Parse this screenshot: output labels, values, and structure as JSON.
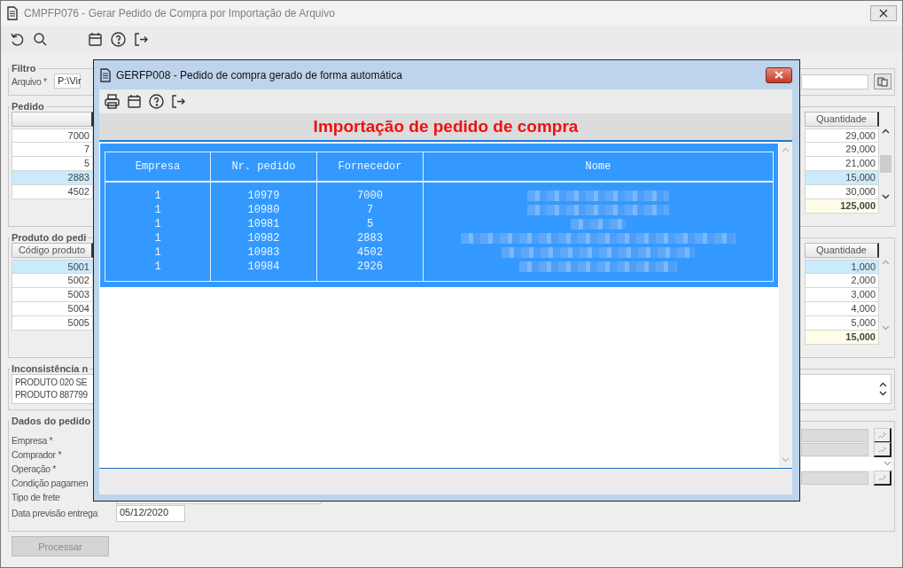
{
  "window": {
    "title": "CMPFP076 - Gerar Pedido de Compra por Importação de Arquivo"
  },
  "toolbar": [
    {
      "kind": "undo"
    },
    {
      "kind": "search"
    },
    {
      "kind": "gap"
    },
    {
      "kind": "calendar"
    },
    {
      "kind": "help"
    },
    {
      "kind": "exit"
    }
  ],
  "filter": {
    "legend": "Filtro",
    "label": "Arquivo *",
    "value": "P:\\Vir"
  },
  "order": {
    "legend": "Pedido",
    "quantity_header": "Quantidade",
    "total": "125,000",
    "rows": [
      {
        "code": "7000",
        "quantity": "29,000",
        "selected": false
      },
      {
        "code": "7",
        "quantity": "29,000",
        "selected": false
      },
      {
        "code": "5",
        "quantity": "21,000",
        "selected": false
      },
      {
        "code": "2883",
        "quantity": "15,000",
        "selected": true
      },
      {
        "code": "4502",
        "quantity": "30,000",
        "selected": false
      }
    ]
  },
  "product": {
    "legend": "Produto do pedi",
    "code_header": "Código produto",
    "quantity_header": "Quantidade",
    "total": "15,000",
    "rows": [
      {
        "code": "5001",
        "quantity": "1,000",
        "selected": true
      },
      {
        "code": "5002",
        "quantity": "2,000",
        "selected": false
      },
      {
        "code": "5003",
        "quantity": "3,000",
        "selected": false
      },
      {
        "code": "5004",
        "quantity": "4,000",
        "selected": false
      },
      {
        "code": "5005",
        "quantity": "5,000",
        "selected": false
      }
    ]
  },
  "inconsistency": {
    "legend": "Inconsistência n",
    "lines": [
      "PRODUTO 020 SE",
      "PRODUTO 887799"
    ]
  },
  "order_data": {
    "legend": "Dados do pedido",
    "fields": [
      {
        "label": "Empresa *",
        "kind": "lookup"
      },
      {
        "label": "Comprador *",
        "kind": "lookup"
      },
      {
        "label": "Operação *",
        "kind": "dropdown"
      },
      {
        "label": "Condição pagamen",
        "kind": "lookup"
      },
      {
        "label": "Tipo de frete",
        "kind": "text"
      },
      {
        "label": "Data previsão entrega",
        "kind": "date",
        "value": "05/12/2020"
      }
    ]
  },
  "process_button": {
    "label": "Processar",
    "disabled": true
  },
  "dialog": {
    "title": "GERFP008 - Pedido de compra gerado de forma automática",
    "toolbar": [
      {
        "kind": "print"
      },
      {
        "kind": "calendar"
      },
      {
        "kind": "help"
      },
      {
        "kind": "exit"
      }
    ],
    "heading": "Importação de pedido de compra",
    "table": {
      "columns": [
        "Empresa",
        "Nr. pedido",
        "Fornecedor",
        "Nome"
      ],
      "rows": [
        {
          "cells": [
            "1",
            "10979",
            "7000"
          ],
          "name_redacted": true
        },
        {
          "cells": [
            "1",
            "10980",
            "7"
          ],
          "name_redacted": true
        },
        {
          "cells": [
            "1",
            "10981",
            "5"
          ],
          "name_redacted": true
        },
        {
          "cells": [
            "1",
            "10982",
            "2883"
          ],
          "name_redacted": true
        },
        {
          "cells": [
            "1",
            "10983",
            "4502"
          ],
          "name_redacted": true
        },
        {
          "cells": [
            "1",
            "10984",
            "2926"
          ],
          "name_redacted": true
        }
      ]
    }
  }
}
